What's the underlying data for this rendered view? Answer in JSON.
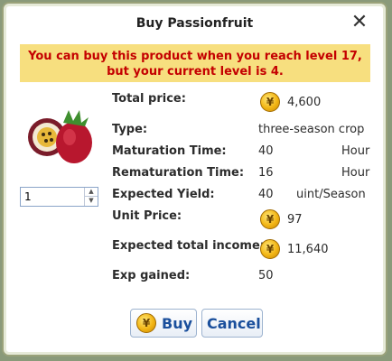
{
  "dialog": {
    "title": "Buy Passionfruit",
    "close_glyph": "✕",
    "warning": "You can buy this product when you reach level 17, but your current level is 4."
  },
  "quantity": {
    "value": "1"
  },
  "details": {
    "total_price": {
      "label": "Total price:",
      "value": "4,600"
    },
    "type": {
      "label": "Type:",
      "value": "three-season crop"
    },
    "maturation": {
      "label": "Maturation Time:",
      "value": "40",
      "unit": "Hours"
    },
    "rematuration": {
      "label": "Rematuration Time:",
      "value": "16",
      "unit": "Hours"
    },
    "yield": {
      "label": "Expected Yield:",
      "value": "40",
      "unit": "uint/Season"
    },
    "unit_price": {
      "label": "Unit Price:",
      "value": "97"
    },
    "income": {
      "label": "Expected total income:",
      "value": "11,640"
    },
    "exp": {
      "label": "Exp gained:",
      "value": "50"
    }
  },
  "coin_symbol": "¥",
  "buttons": {
    "buy": "Buy",
    "cancel": "Cancel"
  },
  "colors": {
    "warning_bg": "#f7df7f",
    "warning_text": "#c40000",
    "button_text": "#1a4f9c",
    "coin": "#f2b514"
  }
}
